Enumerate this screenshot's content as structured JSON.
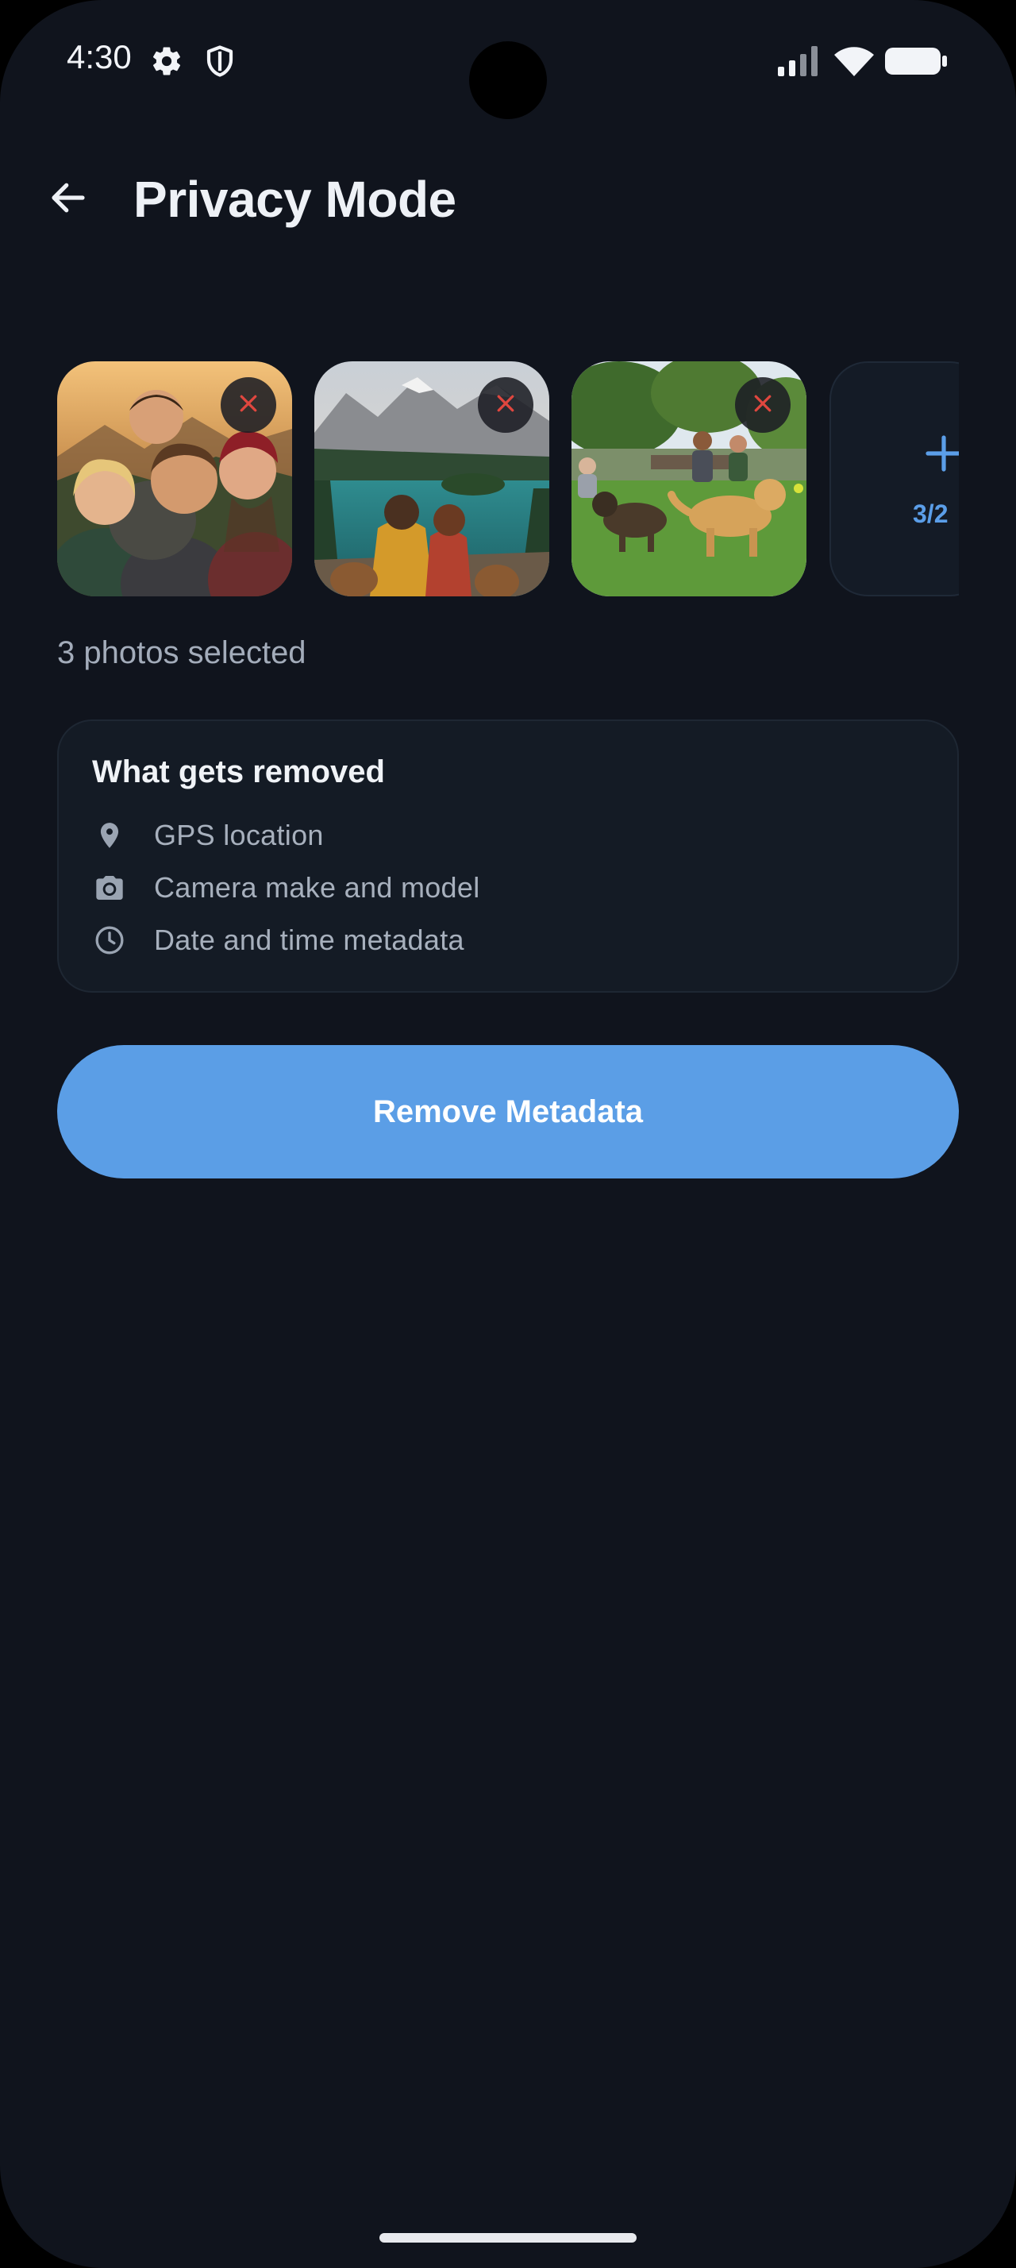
{
  "status_bar": {
    "time": "4:30",
    "icons": [
      "gear-icon",
      "shield-icon",
      "signal-icon",
      "wifi-icon",
      "battery-icon"
    ]
  },
  "header": {
    "title": "Privacy Mode",
    "back_icon": "back-arrow-icon"
  },
  "photos": {
    "items": [
      {
        "scene": "group-selfie",
        "remove_icon": "close-icon"
      },
      {
        "scene": "lake-couple",
        "remove_icon": "close-icon"
      },
      {
        "scene": "park-dogs",
        "remove_icon": "close-icon"
      }
    ],
    "add_tile": {
      "icon": "plus-icon",
      "count_label": "3/2"
    },
    "selected_label": "3 photos selected"
  },
  "info_card": {
    "title": "What gets removed",
    "items": [
      {
        "icon": "location-pin-icon",
        "label": "GPS location"
      },
      {
        "icon": "camera-icon",
        "label": "Camera make and model"
      },
      {
        "icon": "clock-icon",
        "label": "Date and time metadata"
      }
    ]
  },
  "action": {
    "label": "Remove Metadata"
  },
  "colors": {
    "background": "#10141d",
    "accent": "#5b9ee6",
    "card": "#141b25",
    "remove_x": "#e0473f"
  }
}
